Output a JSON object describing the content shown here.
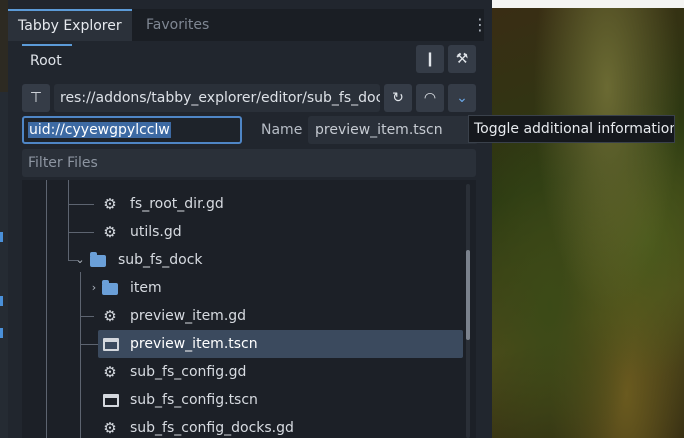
{
  "tabs": {
    "explorer": "Tabby Explorer",
    "favorites": "Favorites"
  },
  "root_tab": "Root",
  "path": {
    "value": "res://addons/tabby_explorer/editor/sub_fs_doc"
  },
  "uid": {
    "value": "uid://cyyewgpylcclw"
  },
  "name_label": "Name",
  "name_value": "preview_item.tscn",
  "tooltip": "Toggle additional information",
  "filter_placeholder": "Filter Files",
  "tree": [
    {
      "label": "fs_root_dir.gd",
      "icon": "gear-icon"
    },
    {
      "label": "utils.gd",
      "icon": "gear-icon"
    },
    {
      "label": "sub_fs_dock",
      "icon": "folder-icon"
    },
    {
      "label": "item",
      "icon": "folder-icon"
    },
    {
      "label": "preview_item.gd",
      "icon": "gear-icon"
    },
    {
      "label": "preview_item.tscn",
      "icon": "scene-icon"
    },
    {
      "label": "sub_fs_config.gd",
      "icon": "gear-icon"
    },
    {
      "label": "sub_fs_config.tscn",
      "icon": "scene-icon"
    },
    {
      "label": "sub_fs_config_docks.gd",
      "icon": "gear-icon"
    }
  ],
  "colors": {
    "accent": "#5c9bd8",
    "selection": "#3b4a5e",
    "folder": "#6a9fd8"
  }
}
